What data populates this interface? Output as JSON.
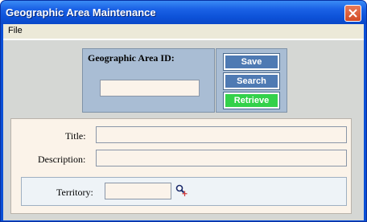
{
  "window": {
    "title": "Geographic Area Maintenance",
    "close_icon": "close-icon"
  },
  "menu": {
    "file": "File"
  },
  "id_section": {
    "label": "Geographic Area ID:",
    "value": ""
  },
  "actions": {
    "save": "Save",
    "search": "Search",
    "retrieve": "Retrieve"
  },
  "form": {
    "title_label": "Title:",
    "title_value": "",
    "description_label": "Description:",
    "description_value": "",
    "territory_label": "Territory:",
    "territory_value": "",
    "territory_lookup_icon": "magnifier-icon"
  },
  "colors": {
    "titlebar": "#0a4fd6",
    "panel_blue": "#a9bdd4",
    "button_blue": "#4e7ab3",
    "button_green": "#33d14a",
    "field_bg": "#fbf3ea"
  }
}
